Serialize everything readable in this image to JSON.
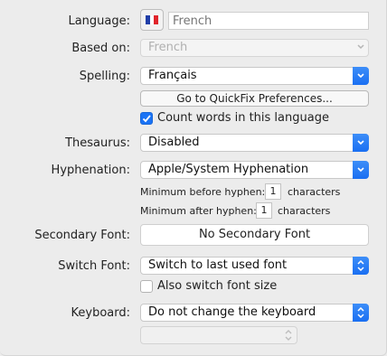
{
  "language": {
    "label": "Language:",
    "placeholder": "French",
    "value": ""
  },
  "based_on": {
    "label": "Based on:",
    "value": "French"
  },
  "spelling": {
    "label": "Spelling:",
    "value": "Français",
    "button": "Go to QuickFix Preferences...",
    "count_words": {
      "label": "Count words in this language",
      "checked": true
    }
  },
  "thesaurus": {
    "label": "Thesaurus:",
    "value": "Disabled"
  },
  "hyphenation": {
    "label": "Hyphenation:",
    "value": "Apple/System Hyphenation",
    "min_before_label": "Minimum before hyphen:",
    "min_before_value": "1",
    "min_before_unit": "characters",
    "min_after_label": "Minimum after hyphen:",
    "min_after_value": "1",
    "min_after_unit": "characters"
  },
  "secondary_font": {
    "label": "Secondary Font:",
    "value": "No Secondary Font"
  },
  "switch_font": {
    "label": "Switch Font:",
    "value": "Switch to last used font",
    "also_switch_size": {
      "label": "Also switch font size",
      "checked": false
    }
  },
  "keyboard": {
    "label": "Keyboard:",
    "value": "Do not change the keyboard",
    "sub_value": ""
  },
  "colors": {
    "accent": "#1a73f5",
    "background": "#ececec"
  }
}
